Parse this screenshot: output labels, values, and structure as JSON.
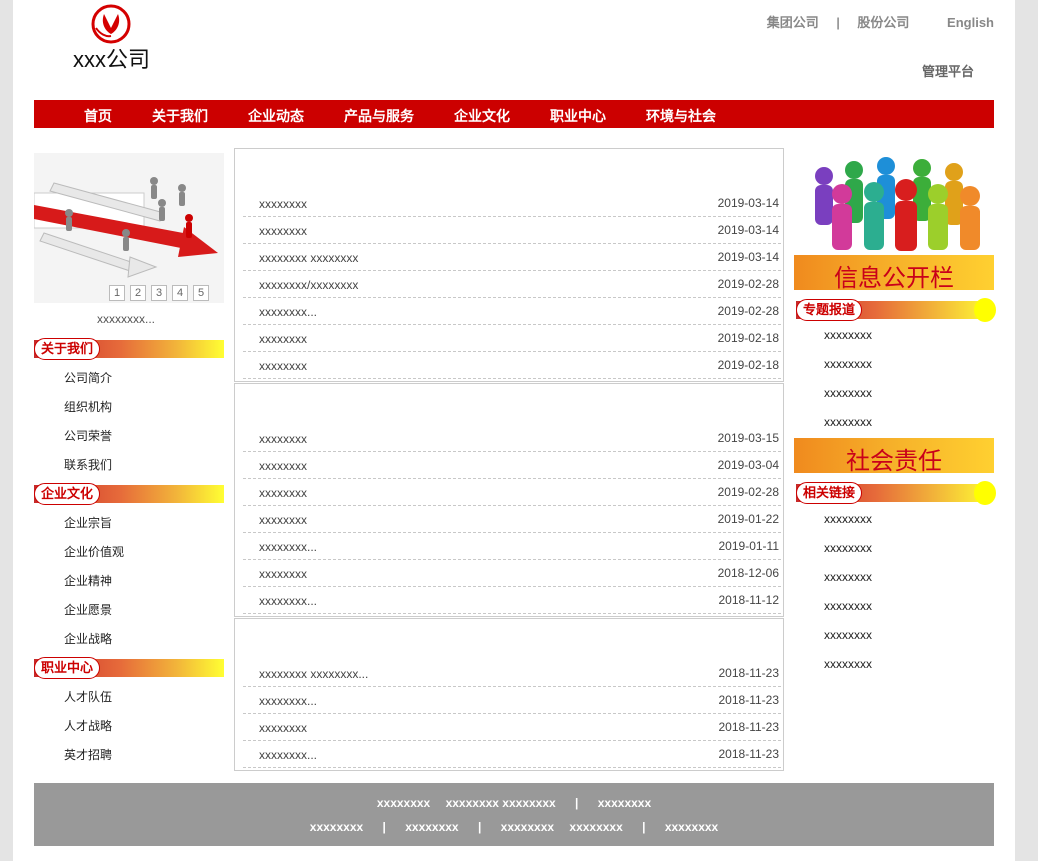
{
  "header": {
    "logo_text": "xxx公司",
    "links": [
      "集团公司",
      "股份公司"
    ],
    "separator": "|",
    "language": "English",
    "admin": "管理平台"
  },
  "nav": [
    "首页",
    "关于我们",
    "企业动态",
    "产品与服务",
    "企业文化",
    "职业中心",
    "环境与社会"
  ],
  "left": {
    "pager": [
      "1",
      "2",
      "3",
      "4",
      "5"
    ],
    "caption": "xxxxxxxx...",
    "sections": [
      {
        "title": "关于我们",
        "items": [
          "公司简介",
          "组织机构",
          "公司荣誉",
          "联系我们"
        ]
      },
      {
        "title": "企业文化",
        "items": [
          "企业宗旨",
          "企业价值观",
          "企业精神",
          "企业愿景",
          "企业战略"
        ]
      },
      {
        "title": "职业中心",
        "items": [
          "人才队伍",
          "人才战略",
          "英才招聘"
        ]
      }
    ]
  },
  "center": {
    "blocks": [
      {
        "rows": [
          {
            "title": "xxxxxxxx",
            "date": "2019-03-14"
          },
          {
            "title": "xxxxxxxx",
            "date": "2019-03-14"
          },
          {
            "title": "xxxxxxxx xxxxxxxx",
            "date": "2019-03-14"
          },
          {
            "title": "xxxxxxxx/xxxxxxxx",
            "date": "2019-02-28"
          },
          {
            "title": "xxxxxxxx...",
            "date": "2019-02-28"
          },
          {
            "title": "xxxxxxxx",
            "date": "2019-02-18"
          },
          {
            "title": "xxxxxxxx",
            "date": "2019-02-18"
          }
        ]
      },
      {
        "rows": [
          {
            "title": "xxxxxxxx",
            "date": "2019-03-15"
          },
          {
            "title": "xxxxxxxx",
            "date": "2019-03-04"
          },
          {
            "title": "xxxxxxxx",
            "date": "2019-02-28"
          },
          {
            "title": "xxxxxxxx",
            "date": "2019-01-22"
          },
          {
            "title": "xxxxxxxx...",
            "date": "2019-01-11"
          },
          {
            "title": "xxxxxxxx",
            "date": "2018-12-06"
          },
          {
            "title": "xxxxxxxx...",
            "date": "2018-11-12"
          }
        ]
      },
      {
        "rows": [
          {
            "title": "xxxxxxxx xxxxxxxx...",
            "date": "2018-11-23"
          },
          {
            "title": "xxxxxxxx...",
            "date": "2018-11-23"
          },
          {
            "title": "xxxxxxxx",
            "date": "2018-11-23"
          },
          {
            "title": "xxxxxxxx...",
            "date": "2018-11-23"
          }
        ]
      }
    ]
  },
  "right": {
    "info_banner": "信息公开栏",
    "special_title": "专题报道",
    "special_items": [
      "xxxxxxxx",
      "xxxxxxxx",
      "xxxxxxxx",
      "xxxxxxxx"
    ],
    "social_banner": "社会责任",
    "links_title": "相关链接",
    "link_items": [
      "xxxxxxxx",
      "xxxxxxxx",
      "xxxxxxxx",
      "xxxxxxxx",
      "xxxxxxxx",
      "xxxxxxxx"
    ]
  },
  "footer": {
    "line1": [
      "xxxxxxxx",
      "xxxxxxxx xxxxxxxx",
      "xxxxxxxx"
    ],
    "line2": [
      "xxxxxxxx",
      "xxxxxxxx",
      "xxxxxxxx",
      "xxxxxxxx",
      "xxxxxxxx"
    ],
    "separator": "|"
  },
  "colors": {
    "brand_red": "#cc0000",
    "footer_gray": "#999999",
    "gradient_end": "#ffff33"
  }
}
